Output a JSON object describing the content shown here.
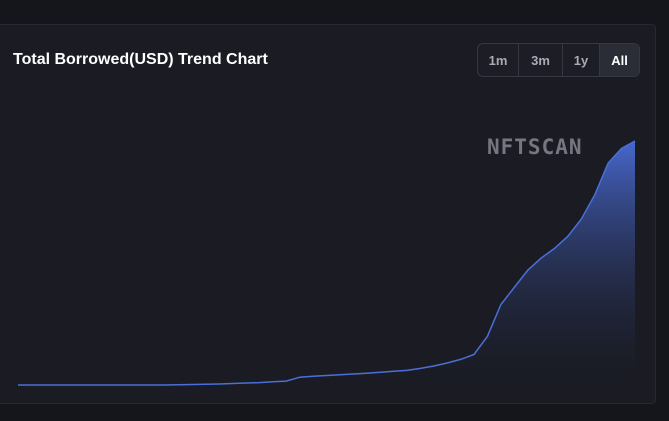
{
  "chart_card": {
    "title": "Total Borrowed(USD) Trend Chart",
    "watermark": "NFTSCAN",
    "ranges": [
      {
        "label": "1m",
        "active": false
      },
      {
        "label": "3m",
        "active": false
      },
      {
        "label": "1y",
        "active": false
      },
      {
        "label": "All",
        "active": true
      }
    ]
  },
  "colors": {
    "line": "#4a6fd8",
    "fill_top": "#4767cc",
    "fill_bottom": "#1a1b23"
  },
  "chart_data": {
    "type": "area",
    "title": "Total Borrowed(USD) Trend Chart",
    "xlabel": "",
    "ylabel": "",
    "grid": false,
    "legend": "none",
    "ylim": [
      0,
      100
    ],
    "series": [
      {
        "values": [
          0,
          0,
          0,
          0,
          0,
          0,
          0,
          0,
          0,
          0,
          0,
          0,
          0.1,
          0.2,
          0.3,
          0.4,
          0.6,
          0.8,
          1.0,
          1.3,
          1.6,
          3.2,
          3.6,
          3.9,
          4.2,
          4.5,
          4.8,
          5.2,
          5.6,
          6.0,
          6.8,
          7.8,
          9.0,
          10.5,
          12.5,
          20,
          33,
          40,
          47,
          52,
          56,
          61,
          68,
          78,
          91,
          97,
          100
        ]
      }
    ]
  }
}
